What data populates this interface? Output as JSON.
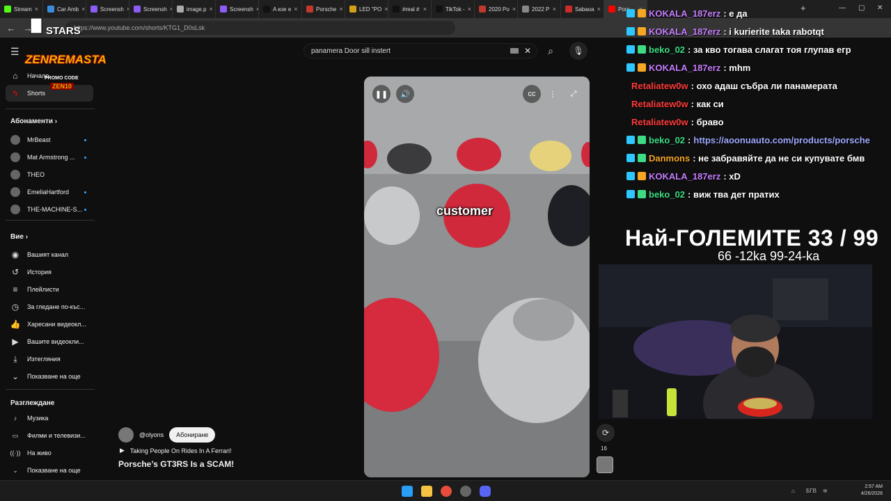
{
  "browser": {
    "tabs": [
      {
        "label": "Stream",
        "color": "#53fc18"
      },
      {
        "label": "Car Amb",
        "color": "#3a8ddb"
      },
      {
        "label": "Screensh",
        "color": "#8b5cf6"
      },
      {
        "label": "Screensh",
        "color": "#8b5cf6"
      },
      {
        "label": "image.p",
        "color": "#aaaaaa"
      },
      {
        "label": "Screensh",
        "color": "#8b5cf6"
      },
      {
        "label": "A кое е",
        "color": "#111111"
      },
      {
        "label": "Porsche",
        "color": "#c0392b"
      },
      {
        "label": "LED \"PO",
        "color": "#d4a017"
      },
      {
        "label": "#real #",
        "color": "#111111"
      },
      {
        "label": "TikTok -",
        "color": "#111111"
      },
      {
        "label": "2020 Po",
        "color": "#c0392b"
      },
      {
        "label": "2022 P",
        "color": "#888888"
      },
      {
        "label": "Sabaoa",
        "color": "#cc2b2b"
      },
      {
        "label": "Pors",
        "color": "#ff0000"
      }
    ],
    "url": "https://www.youtube.com/shorts/KTG1_D0sLsk"
  },
  "youtube": {
    "search_value": "panamera Door sill instert",
    "sidebar": {
      "home": "Начало",
      "shorts": "Shorts",
      "subscriptions_heading": "Абонаменти",
      "subscriptions": [
        {
          "name": "MrBeast",
          "new": true
        },
        {
          "name": "Mat Armstrong ...",
          "new": true
        },
        {
          "name": "THEO",
          "new": false
        },
        {
          "name": "EmeliaHartford",
          "new": true
        },
        {
          "name": "THE-MACHINE-S...",
          "new": true
        }
      ],
      "you_heading": "Вие",
      "you_items": [
        "Вашият канал",
        "История",
        "Плейлисти",
        "За гледане по-къс...",
        "Харесани видеокл...",
        "Вашите видеокли...",
        "Изтегляния",
        "Показване на още"
      ],
      "explore_heading": "Разглеждане",
      "explore_items": [
        "Музика",
        "Филми и телевизи...",
        "На живо",
        "Показване на още"
      ]
    },
    "short": {
      "caption": "customer",
      "channel": "@olyons",
      "subscribe_label": "Абониране",
      "song": "Taking People On Rides In A Ferrari!",
      "title": "Porsche’s GT3RS Is a SCAM!",
      "remix_count": "16"
    }
  },
  "overlay": {
    "logo_top": "STARS",
    "logo_brand": "ZENREMASTA",
    "logo_promo": "PROMO CODE",
    "logo_code": "ZEN10",
    "chat": [
      {
        "user": "KOKALA_187erz",
        "color": "#c77dff",
        "text": ": е да"
      },
      {
        "user": "KOKALA_187erz",
        "color": "#c77dff",
        "text": ": i kurierite taka rabotqt"
      },
      {
        "user": "beko_02",
        "color": "#3ddc84",
        "text": ": за кво тогава слагат тоя глупав егр"
      },
      {
        "user": "KOKALA_187erz",
        "color": "#c77dff",
        "text": ": mhm"
      },
      {
        "user": "Retaliatew0w",
        "color": "#ff3b3b",
        "text": ": охо адаш събра ли панамерата"
      },
      {
        "user": "Retaliatew0w",
        "color": "#ff3b3b",
        "text": ": как си"
      },
      {
        "user": "Retaliatew0w",
        "color": "#ff3b3b",
        "text": ": браво"
      },
      {
        "user": "beko_02",
        "color": "#3ddc84",
        "text": ": ",
        "link": "https://aoonuauto.com/products/porsche"
      },
      {
        "user": "Danmons",
        "color": "#f5a623",
        "text": ": не забравяйте да не си купувате бмв"
      },
      {
        "user": "KOKALA_187erz",
        "color": "#c77dff",
        "text": ": xD"
      },
      {
        "user": "beko_02",
        "color": "#3ddc84",
        "text": ": виж тва дет пратих"
      }
    ],
    "goal_title": "Най-ГОЛЕМИТЕ 33 / 99",
    "goal_sub": "66 -12ka 99-24-ka"
  },
  "taskbar": {
    "lang": "БГВ",
    "time": "2:57 AM",
    "date": "4/26/2026"
  }
}
